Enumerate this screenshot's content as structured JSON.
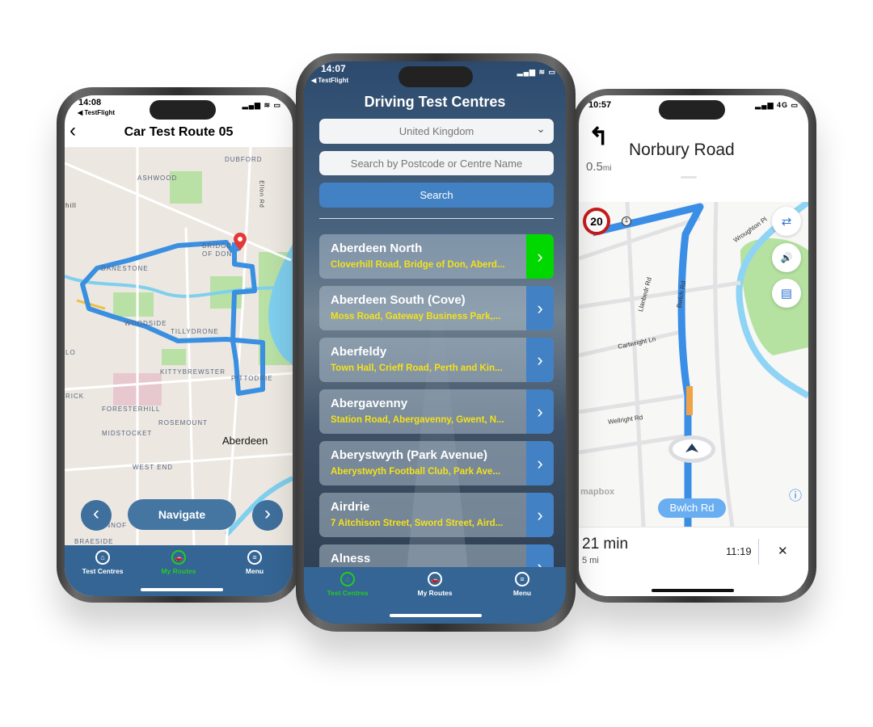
{
  "left_phone": {
    "status": {
      "time": "14:08",
      "back_app": "◀ TestFlight",
      "icons": "▂▄▆ ≋ ▭"
    },
    "header": {
      "back_icon": "‹",
      "title": "Car Test Route 05"
    },
    "map_labels": [
      "DUBFORD",
      "ASHWOOD",
      "hill",
      "Ellon Rd",
      "BRIDGE",
      "OF DON",
      "DANESTONE",
      "WOODSIDE",
      "TILLYDRONE",
      "LO",
      "KITTYBREWSTER",
      "PITTODRIE",
      "RICK",
      "FORESTERHILL",
      "ROSEMOUNT",
      "MIDSTOCKET",
      "Aberdeen",
      "WEST END",
      "ANNOF",
      "BRAESIDE"
    ],
    "controls": {
      "prev": "‹",
      "navigate": "Navigate",
      "next": "›"
    },
    "tabs": [
      {
        "label": "Test Centres",
        "icon": "⌂"
      },
      {
        "label": "My Routes",
        "icon": "🚗",
        "active": true
      },
      {
        "label": "Menu",
        "icon": "≡"
      }
    ]
  },
  "center_phone": {
    "status": {
      "time": "14:07",
      "back_app": "◀ TestFlight",
      "icons": "▂▄▆ ≋ ▭"
    },
    "title": "Driving Test Centres",
    "country_select": {
      "value": "United Kingdom",
      "chevron": "⌄"
    },
    "search_input": {
      "value": "",
      "placeholder": "Search by Postcode or Centre Name"
    },
    "search_button": "Search",
    "centres": [
      {
        "name": "Aberdeen North",
        "address": "Cloverhill Road, Bridge of Don, Aberd...",
        "selected": true
      },
      {
        "name": "Aberdeen South (Cove)",
        "address": "Moss Road, Gateway Business Park,..."
      },
      {
        "name": "Aberfeldy",
        "address": "Town Hall, Crieff Road, Perth and Kin..."
      },
      {
        "name": "Abergavenny",
        "address": "Station Road, Abergavenny, Gwent, N..."
      },
      {
        "name": "Aberystwyth (Park Avenue)",
        "address": "Aberystwyth Football Club, Park Ave..."
      },
      {
        "name": "Airdrie",
        "address": "7 Aitchison Street, Sword Street, Aird..."
      },
      {
        "name": "Alness",
        "address": ""
      }
    ],
    "tabs": [
      {
        "label": "Test Centres",
        "icon": "⌂",
        "active": true
      },
      {
        "label": "My Routes",
        "icon": "🚗"
      },
      {
        "label": "Menu",
        "icon": "≡"
      }
    ],
    "colors": {
      "active": "#22cc22",
      "selected_chevron": "#00d800",
      "chevron": "#4282c4",
      "address": "#f4e11a",
      "tabbar": "#356594"
    }
  },
  "right_phone": {
    "status": {
      "time": "10:57",
      "icons": "▂▄▆ 4G ▭"
    },
    "instruction": {
      "turn_icon": "↰",
      "street": "Norbury Road",
      "distance": "0.5",
      "distance_unit": "mi"
    },
    "speed_limit": "20",
    "map_labels": [
      "Llanbedr Rd",
      "Bwlch Rd",
      "Cartwright Ln",
      "Wellright Rd",
      "Wroughton Pl",
      "1"
    ],
    "side_buttons": [
      {
        "icon": "route-options-icon",
        "glyph": "⇄"
      },
      {
        "icon": "speaker-icon",
        "glyph": "🔊"
      },
      {
        "icon": "feedback-icon",
        "glyph": "▤"
      }
    ],
    "current_road": "Bwlch Rd",
    "attribution": "mapbox",
    "info_icon": "ⓘ",
    "trip": {
      "duration": "21 min",
      "distance": "5 mi",
      "eta": "11:19",
      "close": "✕"
    }
  }
}
